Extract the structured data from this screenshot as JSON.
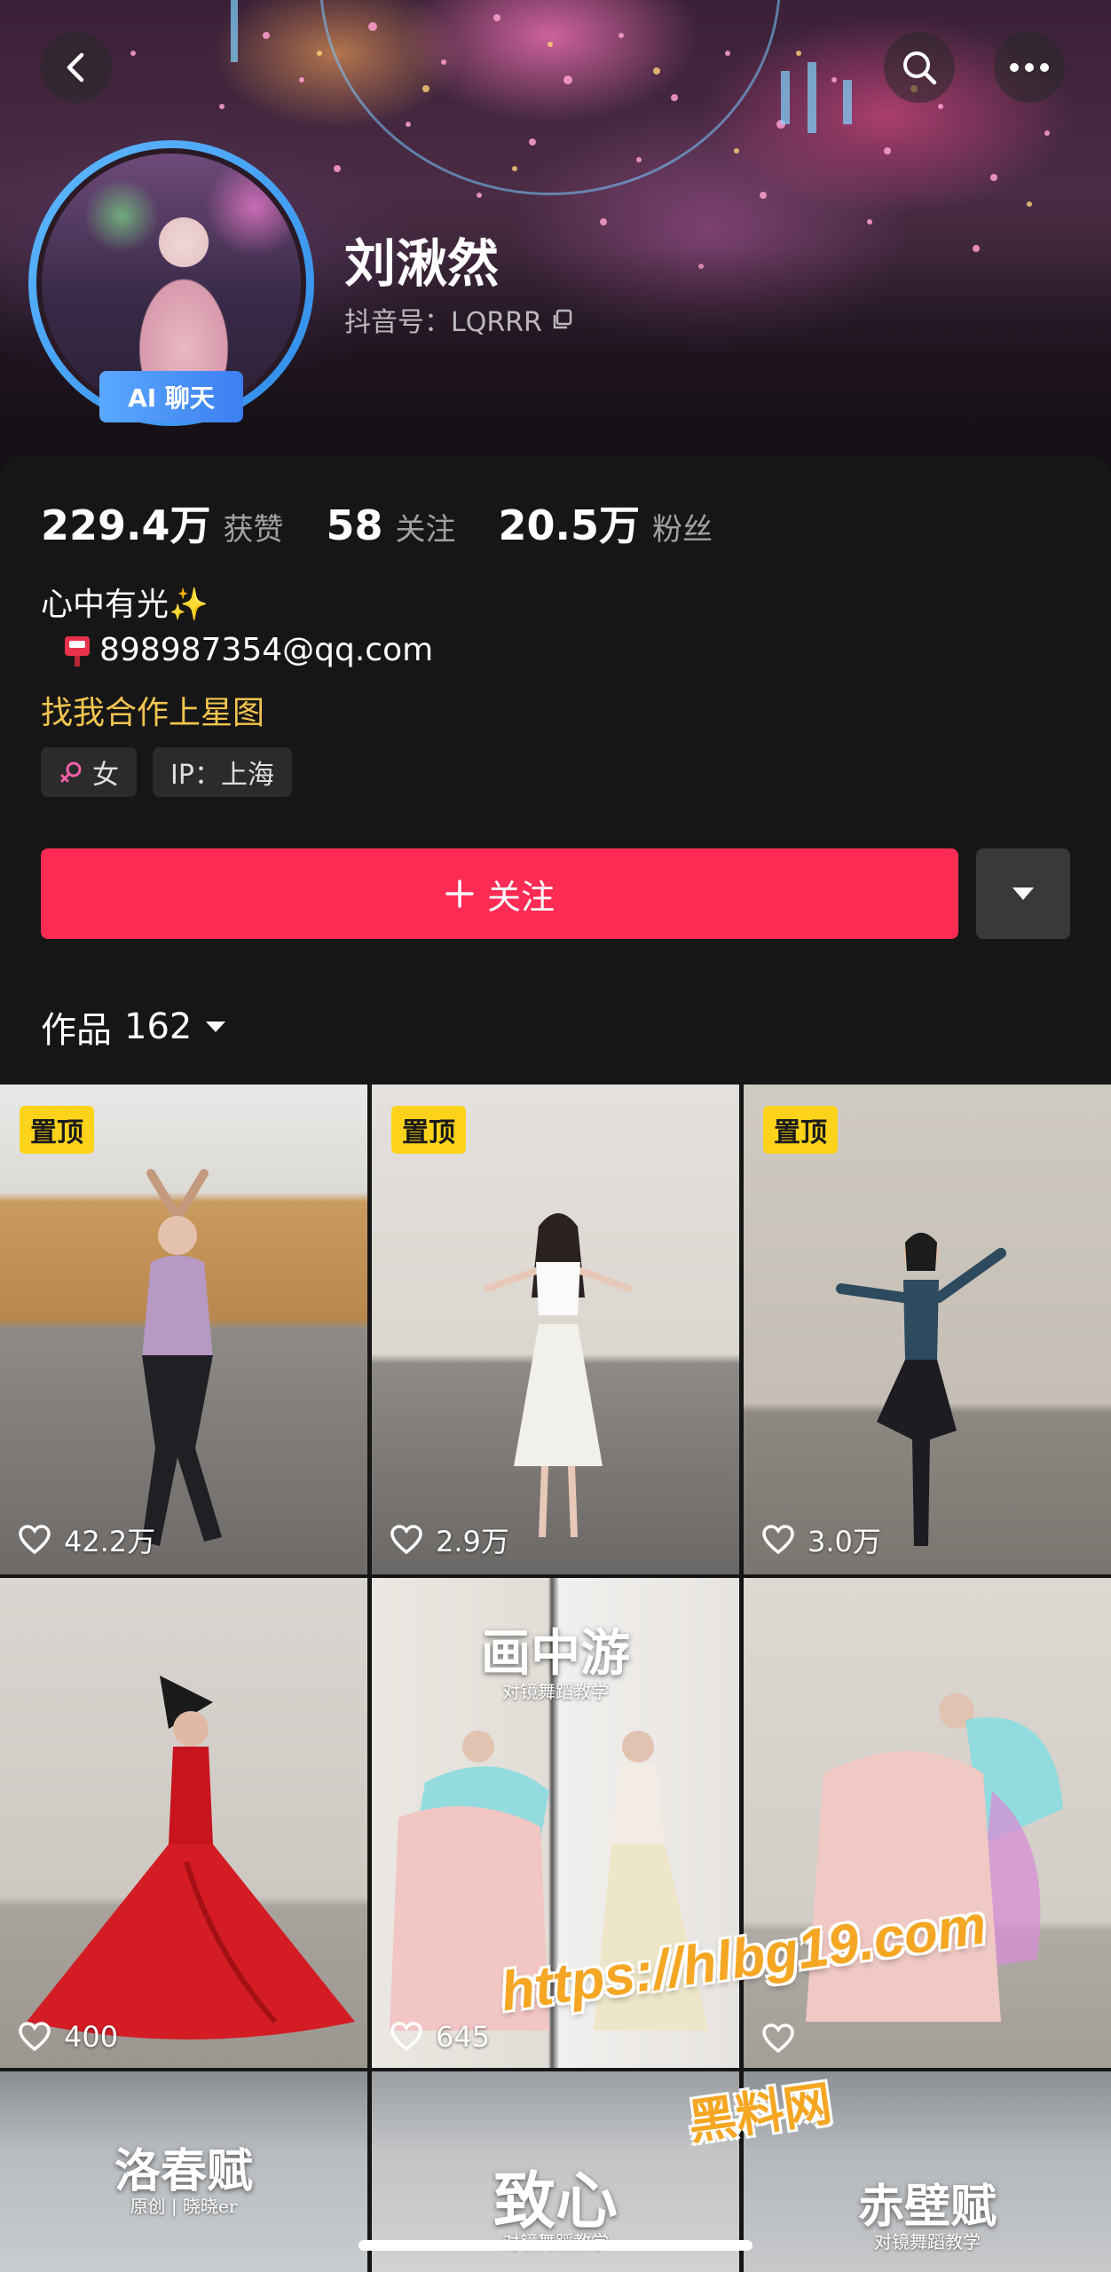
{
  "header": {
    "profile_name": "刘湫然",
    "douyin_id": "抖音号：LQRRR",
    "ai_badge": "AI 聊天",
    "icons": {
      "back": "chevron-left-icon",
      "search": "search-icon",
      "more": "more-icon"
    }
  },
  "stats": [
    {
      "value": "229.4万",
      "label": "获赞"
    },
    {
      "value": "58",
      "label": "关注"
    },
    {
      "value": "20.5万",
      "label": "粉丝"
    }
  ],
  "bio": {
    "line1": "心中有光✨",
    "email": "898987354@qq.com",
    "cooperation": "找我合作上星图"
  },
  "tags": {
    "gender": "女",
    "ip": "IP：上海"
  },
  "actions": {
    "follow_label": "关注"
  },
  "works_tab": {
    "label": "作品",
    "count": "162"
  },
  "videos": [
    {
      "pinned": "置顶",
      "likes": "42.2万"
    },
    {
      "pinned": "置顶",
      "likes": "2.9万"
    },
    {
      "pinned": "置顶",
      "likes": "3.0万"
    },
    {
      "likes": "400"
    },
    {
      "likes": "645",
      "title": "画中游",
      "subtitle": "对镜舞蹈教学"
    },
    {
      "likes": ""
    },
    {
      "title": "洛春赋",
      "subtitle": "原创 | 晓晓er"
    },
    {
      "title": "致心",
      "subtitle": "对镜舞蹈教学"
    },
    {
      "title": "赤壁赋",
      "subtitle": "对镜舞蹈教学"
    }
  ],
  "watermark": {
    "url": "https://hlbg19.com",
    "name": "黑料网"
  },
  "colors": {
    "accent": "#fe2c55",
    "pin_badge": "#fcd31a",
    "link_yellow": "#f2c54f",
    "ai_badge": "#3c7ff0"
  }
}
